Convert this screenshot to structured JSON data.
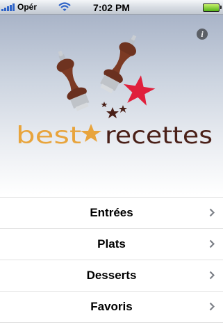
{
  "status_bar": {
    "carrier": "Opér",
    "time": "7:02 PM"
  },
  "header": {
    "logo_text_left": "best",
    "logo_text_right": "recettes",
    "colors": {
      "orange": "#E8A43C",
      "brown": "#4A2018",
      "red_star": "#E0203C"
    }
  },
  "menu": {
    "items": [
      {
        "label": "Entrées"
      },
      {
        "label": "Plats"
      },
      {
        "label": "Desserts"
      },
      {
        "label": "Favoris"
      }
    ]
  }
}
